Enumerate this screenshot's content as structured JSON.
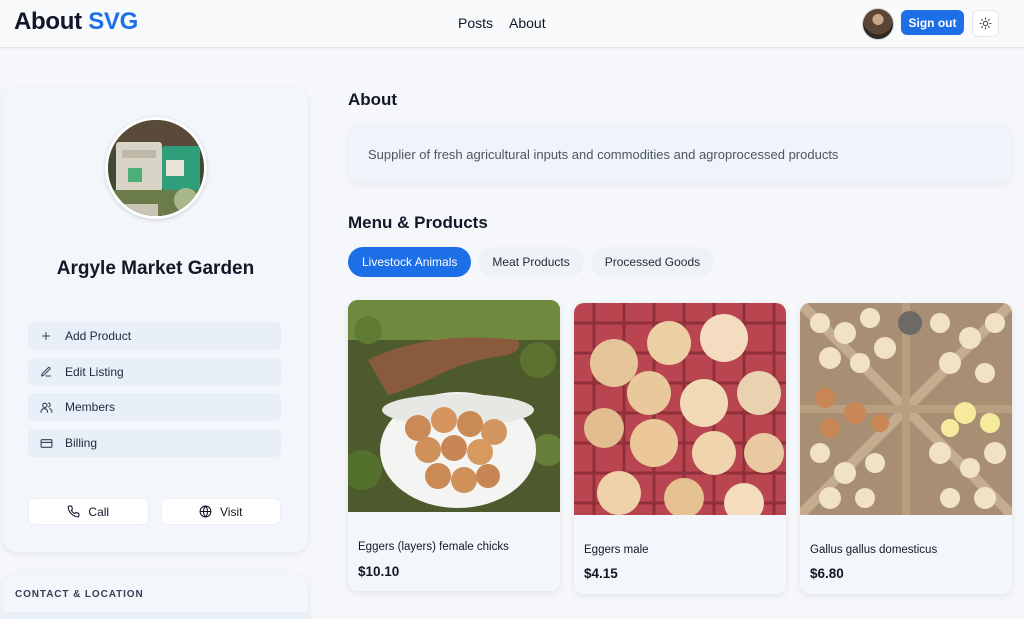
{
  "header": {
    "brand_main": "About",
    "brand_accent": "SVG",
    "nav": [
      "Posts",
      "About"
    ],
    "sign_out": "Sign out",
    "theme_icon": "sun-icon",
    "avatar_icon": "user-avatar"
  },
  "sidebar": {
    "name": "Argyle Market Garden",
    "actions": [
      {
        "label": "Add Product",
        "icon": "plus-icon"
      },
      {
        "label": "Edit Listing",
        "icon": "edit-icon"
      },
      {
        "label": "Members",
        "icon": "users-icon"
      },
      {
        "label": "Billing",
        "icon": "credit-card-icon"
      }
    ],
    "call": "Call",
    "visit": "Visit",
    "contact_title": "CONTACT & LOCATION"
  },
  "main": {
    "about_title": "About",
    "about_text": "Supplier of fresh agricultural inputs and commodities and agroprocessed products",
    "menu_title": "Menu & Products",
    "tabs": [
      "Livestock Animals",
      "Meat Products",
      "Processed Goods"
    ],
    "active_tab": "Livestock Animals",
    "products": [
      {
        "name": "Eggers (layers) female chicks",
        "price": "$10.10"
      },
      {
        "name": "Eggers male",
        "price": "$4.15"
      },
      {
        "name": "Gallus gallus domesticus",
        "price": "$6.80"
      }
    ]
  },
  "colors": {
    "accent": "#1d6fe8",
    "background": "#f5f7fa",
    "card": "#f3f6fb"
  }
}
